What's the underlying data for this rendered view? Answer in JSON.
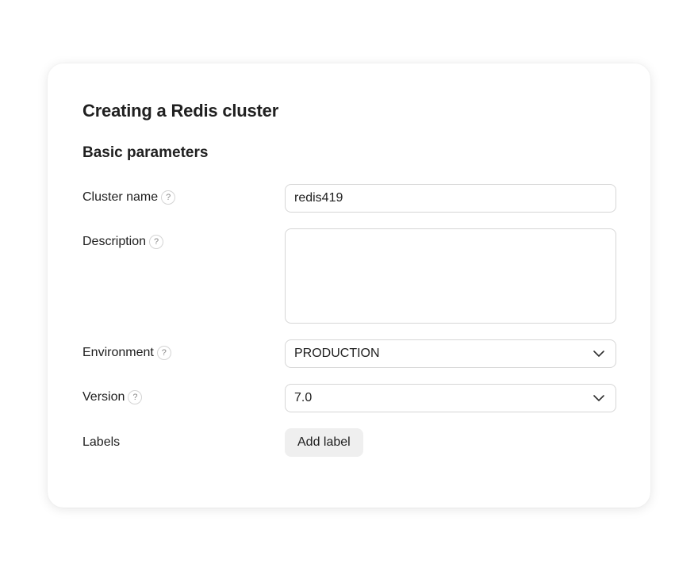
{
  "form": {
    "title": "Creating a Redis cluster",
    "section_title": "Basic parameters",
    "help_glyph": "?",
    "cluster_name": {
      "label": "Cluster name",
      "value": "redis419"
    },
    "description": {
      "label": "Description",
      "value": ""
    },
    "environment": {
      "label": "Environment",
      "value": "PRODUCTION"
    },
    "version": {
      "label": "Version",
      "value": "7.0"
    },
    "labels": {
      "label": "Labels",
      "add_button": "Add label"
    }
  },
  "icons": {
    "help": "question-circle-icon",
    "chevron": "chevron-down-icon"
  }
}
